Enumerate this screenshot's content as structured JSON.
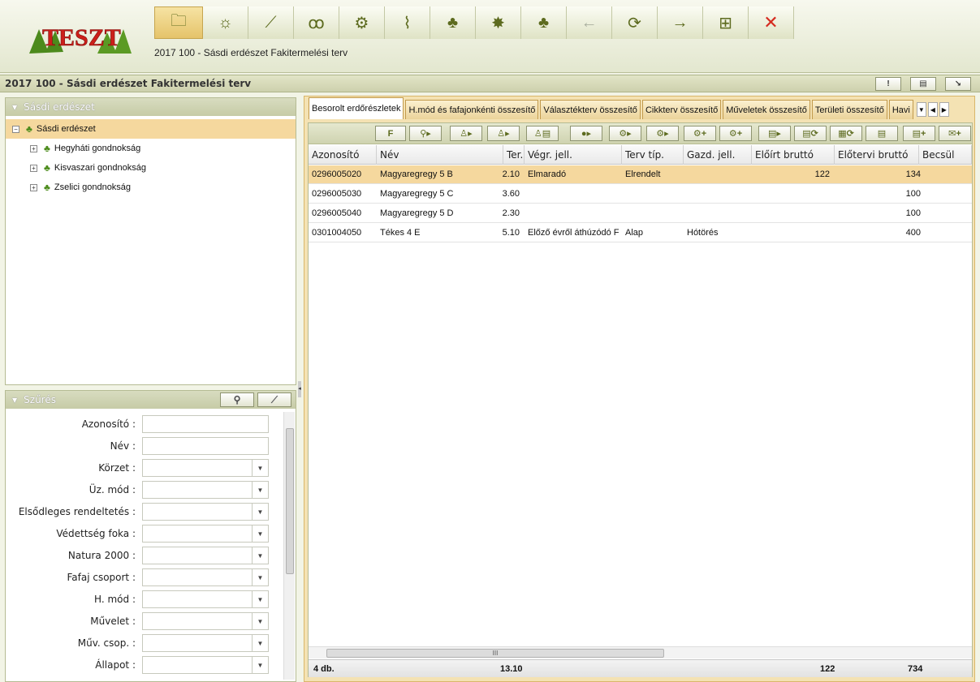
{
  "app": {
    "logo_text": "TESZT",
    "subtitle": "2017 100 - Sásdi erdészet Fakitermelési terv"
  },
  "toolbar": [
    {
      "icon": "folder-forest-icon",
      "glyph": "🗀"
    },
    {
      "icon": "lightbulb-icon",
      "glyph": "☼"
    },
    {
      "icon": "line-chart-icon",
      "glyph": "⟋"
    },
    {
      "icon": "people-icon",
      "glyph": "ꝏ"
    },
    {
      "icon": "gear-icon",
      "glyph": "⚙"
    },
    {
      "icon": "paperclip-icon",
      "glyph": "⌇"
    },
    {
      "icon": "trees-icon",
      "glyph": "♣"
    },
    {
      "icon": "map-icon",
      "glyph": "✸"
    },
    {
      "icon": "folder-trees-icon",
      "glyph": "♣"
    },
    {
      "icon": "arrow-left-icon",
      "glyph": "←"
    },
    {
      "icon": "refresh-icon",
      "glyph": "⟳"
    },
    {
      "icon": "arrow-right-icon",
      "glyph": "→"
    },
    {
      "icon": "grid-icon",
      "glyph": "⊞"
    },
    {
      "icon": "close-icon",
      "glyph": "✕"
    }
  ],
  "titlebar": {
    "title": "2017 100 - Sásdi erdészet Fakitermelési terv",
    "btn1": "!",
    "btn2": "▤",
    "btn3": "↘"
  },
  "tree": {
    "header": "Sásdi erdészet",
    "nodes": [
      {
        "label": "Sásdi erdészet",
        "toggle": "−",
        "level": 0
      },
      {
        "label": "Hegyháti gondnokság",
        "toggle": "+",
        "level": 1
      },
      {
        "label": "Kisvaszari gondnokság",
        "toggle": "+",
        "level": 1
      },
      {
        "label": "Zselici gondnokság",
        "toggle": "+",
        "level": 1
      }
    ]
  },
  "filter": {
    "header": "Szűrés",
    "search_icon": "search-icon",
    "clear_icon": "broom-icon",
    "fields": [
      {
        "label": "Azonosító :",
        "type": "text",
        "value": ""
      },
      {
        "label": "Név :",
        "type": "text",
        "value": ""
      },
      {
        "label": "Körzet :",
        "type": "select",
        "value": ""
      },
      {
        "label": "Üz. mód :",
        "type": "select",
        "value": ""
      },
      {
        "label": "Elsődleges rendeltetés :",
        "type": "select",
        "value": ""
      },
      {
        "label": "Védettség foka :",
        "type": "select",
        "value": ""
      },
      {
        "label": "Natura 2000 :",
        "type": "select",
        "value": ""
      },
      {
        "label": "Fafaj csoport :",
        "type": "select",
        "value": ""
      },
      {
        "label": "H. mód :",
        "type": "select",
        "value": ""
      },
      {
        "label": "Művelet :",
        "type": "select",
        "value": ""
      },
      {
        "label": "Műv. csop. :",
        "type": "select",
        "value": ""
      },
      {
        "label": "Állapot :",
        "type": "select",
        "value": ""
      }
    ]
  },
  "tabs": [
    "Besorolt erdőrészletek",
    "H.mód és fafajonkénti összesítő",
    "Választékterv összesítő",
    "Cikkterv összesítő",
    "Műveletek összesítő",
    "Területi összesítő",
    "Havi"
  ],
  "grid_tools": [
    "F",
    "⚲▸",
    "♙▸",
    "♙▸",
    "♙▤",
    "●▸",
    "⚙▸",
    "⚙▸",
    "⚙+",
    "⚙+",
    "▤▸",
    "▤⟳",
    "▦⟳",
    "▤",
    "▤+",
    "✉+"
  ],
  "grid": {
    "columns": [
      "Azonosító",
      "Név",
      "Ter.",
      "Végr. jell.",
      "Terv típ.",
      "Gazd. jell.",
      "Előírt bruttó",
      "Előtervi bruttó",
      "Becsül"
    ],
    "rows": [
      {
        "id": "0296005020",
        "nev": "Magyaregregy 5 B",
        "ter": "2.10",
        "vegr": "Elmaradó",
        "terv": "Elrendelt",
        "gazd": "",
        "eloirt": "122",
        "elotervi": "134",
        "selected": true
      },
      {
        "id": "0296005030",
        "nev": "Magyaregregy 5 C",
        "ter": "3.60",
        "vegr": "",
        "terv": "",
        "gazd": "",
        "eloirt": "",
        "elotervi": "100",
        "selected": false
      },
      {
        "id": "0296005040",
        "nev": "Magyaregregy 5 D",
        "ter": "2.30",
        "vegr": "",
        "terv": "",
        "gazd": "",
        "eloirt": "",
        "elotervi": "100",
        "selected": false
      },
      {
        "id": "0301004050",
        "nev": "Tékes 4 E",
        "ter": "5.10",
        "vegr": "Előző évről áthúzódó F",
        "terv": "Alap",
        "gazd": "Hótörés",
        "eloirt": "",
        "elotervi": "400",
        "selected": false
      }
    ],
    "footer": {
      "count": "4 db.",
      "ter": "13.10",
      "eloirt": "122",
      "elotervi": "734"
    }
  },
  "colors": {
    "accent": "#f5d89e",
    "panel": "#d8dcc0",
    "close": "#d52a1f"
  }
}
